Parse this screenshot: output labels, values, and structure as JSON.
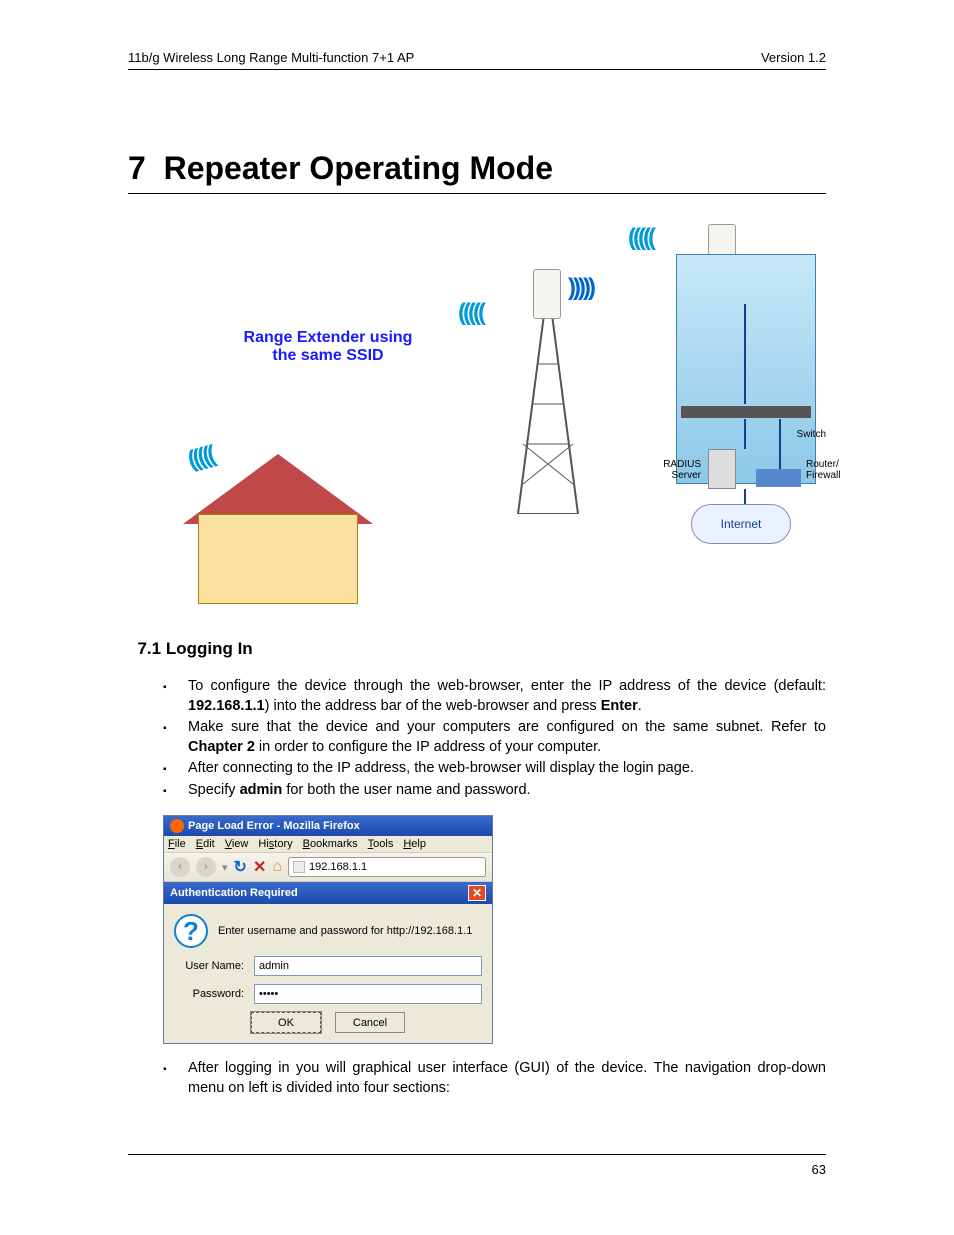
{
  "header": {
    "left": "11b/g Wireless Long Range Multi-function 7+1 AP",
    "right": "Version 1.2"
  },
  "chapter": {
    "number": "7",
    "title": "Repeater Operating Mode"
  },
  "diagram": {
    "caption_line1": "Range Extender using",
    "caption_line2": "the same SSID",
    "labels": {
      "switch": "Switch",
      "radius": "RADIUS Server",
      "router": "Router/ Firewall",
      "internet": "Internet"
    }
  },
  "section": {
    "number": "7.1",
    "title": "Logging In"
  },
  "bullets": [
    {
      "pre": "To configure the device through the web-browser, enter the IP address of the device (default: ",
      "b1": "192.168.1.1",
      "mid": ") into the address bar of the web-browser and press ",
      "b2": "Enter",
      "post": "."
    },
    {
      "pre": "Make sure that the device and your computers are configured on the same subnet. Refer to ",
      "b1": "Chapter 2",
      "post": " in order to configure the IP address of your computer."
    },
    {
      "text": "After connecting to the IP address, the web-browser will display the login page."
    },
    {
      "pre": "Specify ",
      "b1": "admin",
      "post": " for both the user name and password."
    }
  ],
  "firefox": {
    "title": "Page Load Error - Mozilla Firefox",
    "menu": [
      "File",
      "Edit",
      "View",
      "History",
      "Bookmarks",
      "Tools",
      "Help"
    ],
    "url": "192.168.1.1",
    "auth": {
      "title": "Authentication Required",
      "message": "Enter username and password for http://192.168.1.1",
      "user_label": "User Name:",
      "pass_label": "Password:",
      "user_value": "admin",
      "pass_value": "•••••",
      "ok": "OK",
      "cancel": "Cancel"
    }
  },
  "bullets2": [
    {
      "text": "After logging in you will graphical user interface (GUI) of the device. The navigation drop-down menu on left is divided into four sections:"
    }
  ],
  "page_number": "63"
}
